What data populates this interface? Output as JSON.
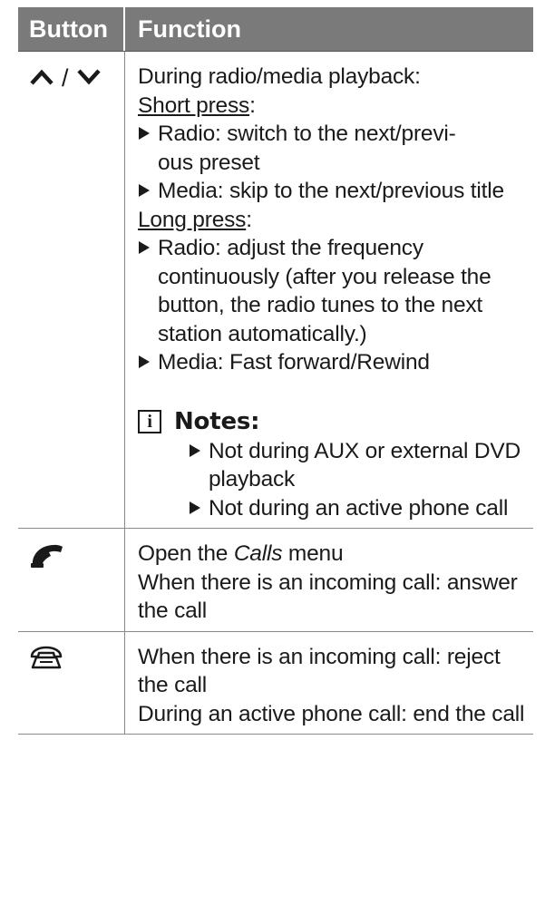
{
  "header": {
    "col_button": "Button",
    "col_function": "Function"
  },
  "rows": [
    {
      "button_icons": [
        "chevron-up-icon",
        "chevron-down-icon"
      ],
      "separator": "/",
      "intro": "During radio/media playback:",
      "short_press_label": "Short press",
      "short_press_colon": ":",
      "short_press_items": [
        "Radio: switch to the next/previ- ous preset",
        "Media: skip to the next/previous title"
      ],
      "long_press_label": "Long press",
      "long_press_colon": ":",
      "long_press_items": [
        "Radio: adjust the frequency continuously (after you release the button, the radio tunes to the next station automatically.)",
        "Media: Fast forward/Rewind"
      ],
      "notes_icon": "i",
      "notes_title": "Notes:",
      "notes_items": [
        "Not during AUX or external DVD playback",
        "Not during an active phone call"
      ]
    },
    {
      "button_icon": "phone-answer-icon",
      "line1_before": "Open the ",
      "line1_italic": "Calls",
      "line1_after": " menu",
      "line2": "When there is an incoming call: answer the call"
    },
    {
      "button_icon": "phone-hangup-icon",
      "line1": "When there is an incoming call: reject the call",
      "line2": "During an active phone call: end the call"
    }
  ]
}
